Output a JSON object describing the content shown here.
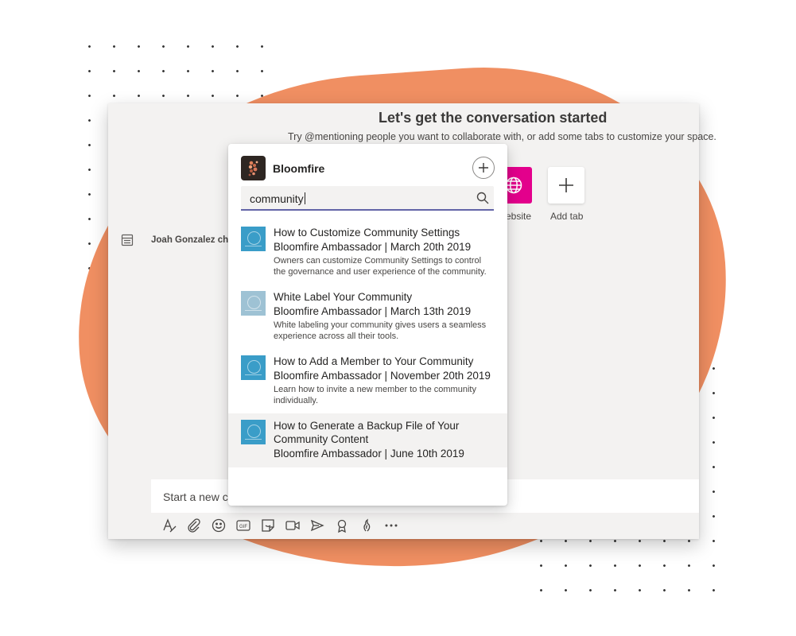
{
  "colors": {
    "blob": "#f08f62",
    "teams_bg": "#f3f2f1",
    "website_tile": "#e3008c",
    "search_underline": "#6264a7",
    "thumb": "#3a9dc8"
  },
  "welcome": {
    "title": "Let's get the conversation started",
    "subtitle": "Try @mentioning people you want to collaborate with, or add some tabs to customize your space."
  },
  "tiles": {
    "website_label": "ebsite",
    "website_icon": "globe-icon",
    "add_tab_label": "Add tab",
    "add_tab_icon": "plus-icon"
  },
  "activity": {
    "icon": "document-list-icon",
    "text": "Joah Gonzalez cha"
  },
  "compose": {
    "placeholder": "Start a new co"
  },
  "toolbar": {
    "icons": [
      "format-icon",
      "attach-icon",
      "emoji-icon",
      "gif-icon",
      "sticker-icon",
      "meet-now-icon",
      "send-arrow-icon",
      "praise-icon",
      "bloomfire-icon",
      "more-icon"
    ]
  },
  "popup": {
    "app_name": "Bloomfire",
    "add_icon": "plus-icon",
    "search_value": "community",
    "search_icon": "search-icon",
    "results": [
      {
        "title": "How to Customize Community Settings",
        "meta": "Bloomfire Ambassador | March 20th 2019",
        "desc": "Owners can customize Community Settings to control the governance and user experience of the community."
      },
      {
        "title": "White Label Your Community",
        "meta": "Bloomfire Ambassador | March 13th 2019",
        "desc": "White labeling your community gives users a seamless experience across all their tools."
      },
      {
        "title": "How to Add a Member to Your Community",
        "meta": "Bloomfire Ambassador | November 20th 2019",
        "desc": "Learn how to invite a new member to the community individually."
      },
      {
        "title": "How to Generate a Backup File of Your Community Content",
        "meta": "Bloomfire Ambassador | June 10th 2019",
        "desc": ""
      }
    ]
  }
}
